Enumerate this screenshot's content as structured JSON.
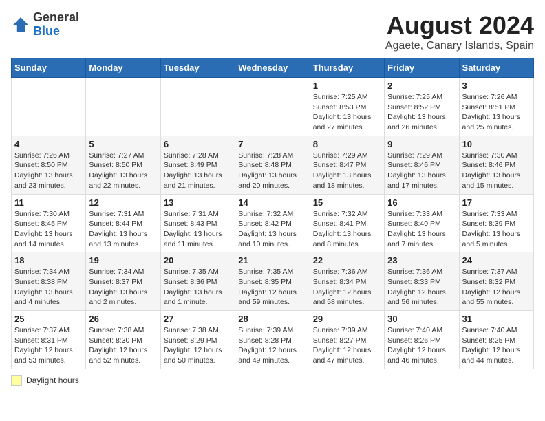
{
  "header": {
    "logo_general": "General",
    "logo_blue": "Blue",
    "main_title": "August 2024",
    "subtitle": "Agaete, Canary Islands, Spain"
  },
  "days_of_week": [
    "Sunday",
    "Monday",
    "Tuesday",
    "Wednesday",
    "Thursday",
    "Friday",
    "Saturday"
  ],
  "legend_label": "Daylight hours",
  "weeks": [
    [
      {
        "day": "",
        "info": ""
      },
      {
        "day": "",
        "info": ""
      },
      {
        "day": "",
        "info": ""
      },
      {
        "day": "",
        "info": ""
      },
      {
        "day": "1",
        "info": "Sunrise: 7:25 AM\nSunset: 8:53 PM\nDaylight: 13 hours and 27 minutes."
      },
      {
        "day": "2",
        "info": "Sunrise: 7:25 AM\nSunset: 8:52 PM\nDaylight: 13 hours and 26 minutes."
      },
      {
        "day": "3",
        "info": "Sunrise: 7:26 AM\nSunset: 8:51 PM\nDaylight: 13 hours and 25 minutes."
      }
    ],
    [
      {
        "day": "4",
        "info": "Sunrise: 7:26 AM\nSunset: 8:50 PM\nDaylight: 13 hours and 23 minutes."
      },
      {
        "day": "5",
        "info": "Sunrise: 7:27 AM\nSunset: 8:50 PM\nDaylight: 13 hours and 22 minutes."
      },
      {
        "day": "6",
        "info": "Sunrise: 7:28 AM\nSunset: 8:49 PM\nDaylight: 13 hours and 21 minutes."
      },
      {
        "day": "7",
        "info": "Sunrise: 7:28 AM\nSunset: 8:48 PM\nDaylight: 13 hours and 20 minutes."
      },
      {
        "day": "8",
        "info": "Sunrise: 7:29 AM\nSunset: 8:47 PM\nDaylight: 13 hours and 18 minutes."
      },
      {
        "day": "9",
        "info": "Sunrise: 7:29 AM\nSunset: 8:46 PM\nDaylight: 13 hours and 17 minutes."
      },
      {
        "day": "10",
        "info": "Sunrise: 7:30 AM\nSunset: 8:46 PM\nDaylight: 13 hours and 15 minutes."
      }
    ],
    [
      {
        "day": "11",
        "info": "Sunrise: 7:30 AM\nSunset: 8:45 PM\nDaylight: 13 hours and 14 minutes."
      },
      {
        "day": "12",
        "info": "Sunrise: 7:31 AM\nSunset: 8:44 PM\nDaylight: 13 hours and 13 minutes."
      },
      {
        "day": "13",
        "info": "Sunrise: 7:31 AM\nSunset: 8:43 PM\nDaylight: 13 hours and 11 minutes."
      },
      {
        "day": "14",
        "info": "Sunrise: 7:32 AM\nSunset: 8:42 PM\nDaylight: 13 hours and 10 minutes."
      },
      {
        "day": "15",
        "info": "Sunrise: 7:32 AM\nSunset: 8:41 PM\nDaylight: 13 hours and 8 minutes."
      },
      {
        "day": "16",
        "info": "Sunrise: 7:33 AM\nSunset: 8:40 PM\nDaylight: 13 hours and 7 minutes."
      },
      {
        "day": "17",
        "info": "Sunrise: 7:33 AM\nSunset: 8:39 PM\nDaylight: 13 hours and 5 minutes."
      }
    ],
    [
      {
        "day": "18",
        "info": "Sunrise: 7:34 AM\nSunset: 8:38 PM\nDaylight: 13 hours and 4 minutes."
      },
      {
        "day": "19",
        "info": "Sunrise: 7:34 AM\nSunset: 8:37 PM\nDaylight: 13 hours and 2 minutes."
      },
      {
        "day": "20",
        "info": "Sunrise: 7:35 AM\nSunset: 8:36 PM\nDaylight: 13 hours and 1 minute."
      },
      {
        "day": "21",
        "info": "Sunrise: 7:35 AM\nSunset: 8:35 PM\nDaylight: 12 hours and 59 minutes."
      },
      {
        "day": "22",
        "info": "Sunrise: 7:36 AM\nSunset: 8:34 PM\nDaylight: 12 hours and 58 minutes."
      },
      {
        "day": "23",
        "info": "Sunrise: 7:36 AM\nSunset: 8:33 PM\nDaylight: 12 hours and 56 minutes."
      },
      {
        "day": "24",
        "info": "Sunrise: 7:37 AM\nSunset: 8:32 PM\nDaylight: 12 hours and 55 minutes."
      }
    ],
    [
      {
        "day": "25",
        "info": "Sunrise: 7:37 AM\nSunset: 8:31 PM\nDaylight: 12 hours and 53 minutes."
      },
      {
        "day": "26",
        "info": "Sunrise: 7:38 AM\nSunset: 8:30 PM\nDaylight: 12 hours and 52 minutes."
      },
      {
        "day": "27",
        "info": "Sunrise: 7:38 AM\nSunset: 8:29 PM\nDaylight: 12 hours and 50 minutes."
      },
      {
        "day": "28",
        "info": "Sunrise: 7:39 AM\nSunset: 8:28 PM\nDaylight: 12 hours and 49 minutes."
      },
      {
        "day": "29",
        "info": "Sunrise: 7:39 AM\nSunset: 8:27 PM\nDaylight: 12 hours and 47 minutes."
      },
      {
        "day": "30",
        "info": "Sunrise: 7:40 AM\nSunset: 8:26 PM\nDaylight: 12 hours and 46 minutes."
      },
      {
        "day": "31",
        "info": "Sunrise: 7:40 AM\nSunset: 8:25 PM\nDaylight: 12 hours and 44 minutes."
      }
    ]
  ]
}
